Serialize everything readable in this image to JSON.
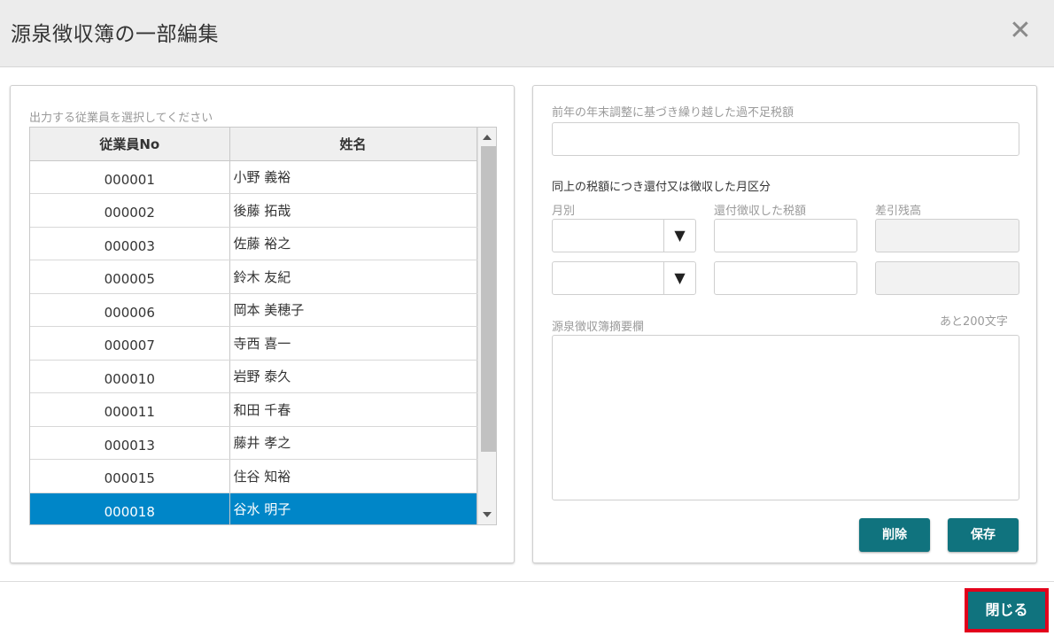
{
  "dialog": {
    "title": "源泉徴収簿の一部編集",
    "close_symbol": "✕"
  },
  "left": {
    "label": "出力する従業員を選択してください",
    "columns": {
      "no": "従業員No",
      "name": "姓名"
    },
    "rows": [
      {
        "no": "000001",
        "name": "小野 義裕"
      },
      {
        "no": "000002",
        "name": "後藤 拓哉"
      },
      {
        "no": "000003",
        "name": "佐藤 裕之"
      },
      {
        "no": "000005",
        "name": "鈴木 友紀"
      },
      {
        "no": "000006",
        "name": "岡本 美穂子"
      },
      {
        "no": "000007",
        "name": "寺西 喜一"
      },
      {
        "no": "000010",
        "name": "岩野 泰久"
      },
      {
        "no": "000011",
        "name": "和田 千春"
      },
      {
        "no": "000013",
        "name": "藤井 孝之"
      },
      {
        "no": "000015",
        "name": "住谷 知裕"
      },
      {
        "no": "000018",
        "name": "谷水 明子"
      }
    ],
    "selected_index": 10
  },
  "right": {
    "prev_year_label": "前年の年末調整に基づき繰り越した過不足税額",
    "prev_year_value": "",
    "section_label": "同上の税額につき還付又は徴収した月区分",
    "month_label": "月別",
    "refund_label": "還付徴収した税額",
    "balance_label": "差引残高",
    "dropdown_arrow": "▼",
    "rows": [
      {
        "month": "",
        "refund": "",
        "balance": ""
      },
      {
        "month": "",
        "refund": "",
        "balance": ""
      }
    ],
    "summary_label": "源泉徴収簿摘要欄",
    "summary_counter": "あと200文字",
    "summary_value": "",
    "delete_label": "削除",
    "save_label": "保存"
  },
  "footer": {
    "close_label": "閉じる"
  },
  "colors": {
    "accent": "#10737e",
    "selected_row": "#0086c8",
    "highlight_border": "#e3001b"
  }
}
